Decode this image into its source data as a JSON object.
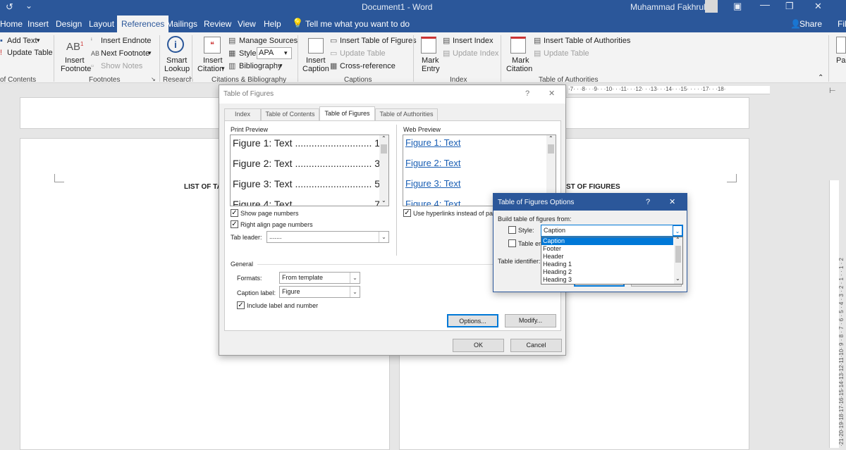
{
  "titlebar": {
    "doc_title": "Document1  -  Word",
    "user": "Muhammad Fakhrullah"
  },
  "tabs": [
    "Home",
    "Insert",
    "Design",
    "Layout",
    "References",
    "Mailings",
    "Review",
    "View",
    "Help"
  ],
  "tell_me": "Tell me what you want to do",
  "share": "Share",
  "file_partial": "Fil",
  "ribbon": {
    "toc": {
      "add_text": "Add Text",
      "update_table": "Update Table",
      "group": "of Contents"
    },
    "footnotes": {
      "ab": "AB",
      "insert_footnote_1": "Insert",
      "insert_footnote_2": "Footnote",
      "insert_endnote": "Insert Endnote",
      "next_footnote": "Next Footnote",
      "show_notes": "Show Notes",
      "group": "Footnotes"
    },
    "research": {
      "smart_lookup_1": "Smart",
      "smart_lookup_2": "Lookup",
      "group": "Research"
    },
    "citations": {
      "insert_citation_1": "Insert",
      "insert_citation_2": "Citation",
      "manage_sources": "Manage Sources",
      "style_label": "Style:",
      "style_value": "APA",
      "bibliography": "Bibliography",
      "group": "Citations & Bibliography"
    },
    "captions": {
      "insert_caption_1": "Insert",
      "insert_caption_2": "Caption",
      "insert_tof": "Insert Table of Figures",
      "update_table": "Update Table",
      "cross_reference": "Cross-reference",
      "group": "Captions"
    },
    "index": {
      "mark_entry_1": "Mark",
      "mark_entry_2": "Entry",
      "insert_index": "Insert Index",
      "update_index": "Update Index",
      "group": "Index"
    },
    "toa": {
      "mark_citation_1": "Mark",
      "mark_citation_2": "Citation",
      "insert_toa": "Insert Table of Authorities",
      "update_table": "Update Table",
      "group": "Table of Authorities"
    },
    "paste_partial": "Pas"
  },
  "ruler_text": "·7· · ·8· · ·9· · ·10· · ·11· · ·12· · ·13· · ·14· · ·15· · · · ·17· · ·18·",
  "vruler_text": "·21·20·19·18·17·16·15·14·13·12·11·10· 9 · 8 · 7 · 6 · 5 · 4 · 3 · 2 · 1 · · 1 · 2",
  "document": {
    "left_heading": "LIST OF TAB",
    "right_heading": "ST OF FIGURES"
  },
  "tof_dialog": {
    "title": "Table of Figures",
    "help": "?",
    "close": "✕",
    "tabs": [
      "Index",
      "Table of Contents",
      "Table of Figures",
      "Table of Authorities"
    ],
    "print_preview_label": "Print Preview",
    "print_preview": [
      "Figure 1: Text ............................ 1",
      "Figure 2: Text ............................ 3",
      "Figure 3: Text ............................ 5",
      "Figure 4: Text ............................ 7"
    ],
    "web_preview_label": "Web Preview",
    "web_preview": [
      "Figure 1: Text",
      "Figure 2: Text",
      "Figure 3: Text",
      "Figure 4: Text"
    ],
    "show_page_numbers": "Show page numbers",
    "right_align": "Right align page numbers",
    "tab_leader_label": "Tab leader:",
    "tab_leader_value": ".......",
    "use_hyperlinks": "Use hyperlinks instead of page",
    "general_label": "General",
    "formats_label": "Formats:",
    "formats_value": "From template",
    "caption_label_label": "Caption label:",
    "caption_label_value": "Figure",
    "include_label": "Include label and number",
    "options": "Options...",
    "modify": "Modify...",
    "ok": "OK",
    "cancel": "Cancel"
  },
  "options_dialog": {
    "title": "Table of Figures Options",
    "help": "?",
    "close": "✕",
    "build_label": "Build table of figures from:",
    "style_label": "Style:",
    "style_value": "Caption",
    "table_entry": "Table en",
    "table_identifier": "Table identifier:",
    "options": [
      "Caption",
      "Footer",
      "Header",
      "Heading 1",
      "Heading 2",
      "Heading 3"
    ],
    "selected": "Caption"
  },
  "colors": {
    "word_blue": "#2b579a",
    "selection": "#0078d7",
    "link": "#1a5fb4"
  }
}
